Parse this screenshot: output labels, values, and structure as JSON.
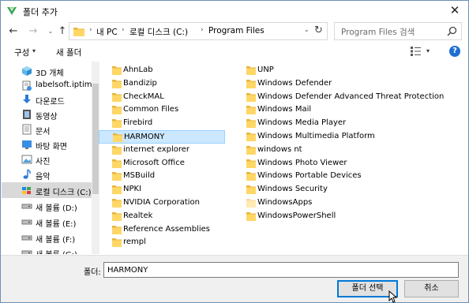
{
  "window": {
    "title": "폴더 추가",
    "close_glyph": "✕"
  },
  "navigation": {
    "back": "←",
    "forward": "→",
    "recent": "⌄",
    "up": "↑"
  },
  "address": {
    "segments": [
      "내 PC",
      "로컬 디스크 (C:)",
      "Program Files"
    ],
    "separator": "›",
    "dropdown": "⌄",
    "refresh": "↻"
  },
  "search": {
    "placeholder": "Program Files 검색"
  },
  "toolbar": {
    "organize": "구성",
    "organize_caret": "▾",
    "new_folder": "새 폴더",
    "view_caret": "▾",
    "help": "?"
  },
  "sidebar": {
    "items": [
      {
        "label": "3D 개체",
        "icon": "3d-objects-icon"
      },
      {
        "label": "labelsoft.iptime.",
        "icon": "network-drive-icon"
      },
      {
        "label": "다운로드",
        "icon": "download-icon"
      },
      {
        "label": "동영상",
        "icon": "video-icon"
      },
      {
        "label": "문서",
        "icon": "document-icon"
      },
      {
        "label": "바탕 화면",
        "icon": "desktop-icon"
      },
      {
        "label": "사진",
        "icon": "pictures-icon"
      },
      {
        "label": "음악",
        "icon": "music-icon"
      },
      {
        "label": "로컬 디스크 (C:)",
        "icon": "local-disk-icon",
        "selected": true
      },
      {
        "label": "새 볼륨 (D:)",
        "icon": "drive-icon"
      },
      {
        "label": "새 볼륨 (E:)",
        "icon": "drive-icon"
      },
      {
        "label": "새 볼륨 (F:)",
        "icon": "drive-icon"
      },
      {
        "label": "새 볼륨 (G:)",
        "icon": "drive-icon"
      }
    ]
  },
  "files": {
    "column1": [
      "AhnLab",
      "Bandizip",
      "CheckMAL",
      "Common Files",
      "Firebird",
      "HARMONY",
      "internet explorer",
      "Microsoft Office",
      "MSBuild",
      "NPKI",
      "NVIDIA Corporation",
      "Realtek",
      "Reference Assemblies",
      "rempl"
    ],
    "column2": [
      "UNP",
      "Windows Defender",
      "Windows Defender Advanced Threat Protection",
      "Windows Mail",
      "Windows Media Player",
      "Windows Multimedia Platform",
      "windows nt",
      "Windows Photo Viewer",
      "Windows Portable Devices",
      "Windows Security",
      "WindowsApps",
      "WindowsPowerShell"
    ],
    "selected": "HARMONY",
    "faded": [
      "WindowsApps"
    ]
  },
  "footer": {
    "folder_label": "폴더:",
    "folder_value": "HARMONY",
    "select_button": "폴더 선택",
    "cancel_button": "취소"
  },
  "colors": {
    "folder": "#ffd766",
    "folder_dark": "#e8b53c",
    "selection": "#cce8ff",
    "accent": "#0078d7",
    "app_icon": "#3aa655"
  }
}
